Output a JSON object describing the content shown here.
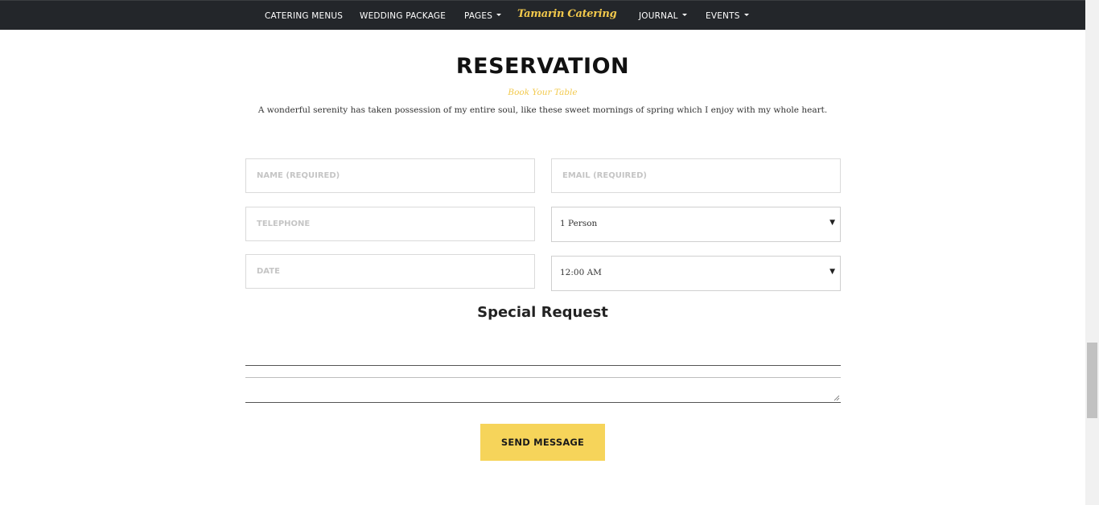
{
  "nav": {
    "items_left": [
      {
        "label": "CATERING MENUS",
        "dropdown": false
      },
      {
        "label": "WEDDING PACKAGE",
        "dropdown": false
      },
      {
        "label": "PAGES",
        "dropdown": true
      }
    ],
    "brand": "Tamarin Catering",
    "items_right": [
      {
        "label": "JOURNAL",
        "dropdown": true
      },
      {
        "label": "EVENTS",
        "dropdown": true
      }
    ]
  },
  "section": {
    "title": "RESERVATION",
    "subtitle": "Book Your Table",
    "intro": "A wonderful serenity has taken possession of my entire soul, like these sweet mornings of spring which I enjoy with my whole heart."
  },
  "form": {
    "name_placeholder": "NAME (REQUIRED)",
    "email_placeholder": "EMAIL (REQUIRED)",
    "telephone_placeholder": "TELEPHONE",
    "date_placeholder": "DATE",
    "persons_selected": "1 Person",
    "time_selected": "12:00 AM",
    "special_request_title": "Special Request",
    "send_label": "SEND MESSAGE"
  },
  "colors": {
    "nav_bg": "#23262a",
    "accent": "#f2c94c",
    "button_bg": "#f6d45a"
  },
  "icons": {
    "dropdown": "caret-down-icon",
    "select_arrow": "triangle-down-icon"
  }
}
